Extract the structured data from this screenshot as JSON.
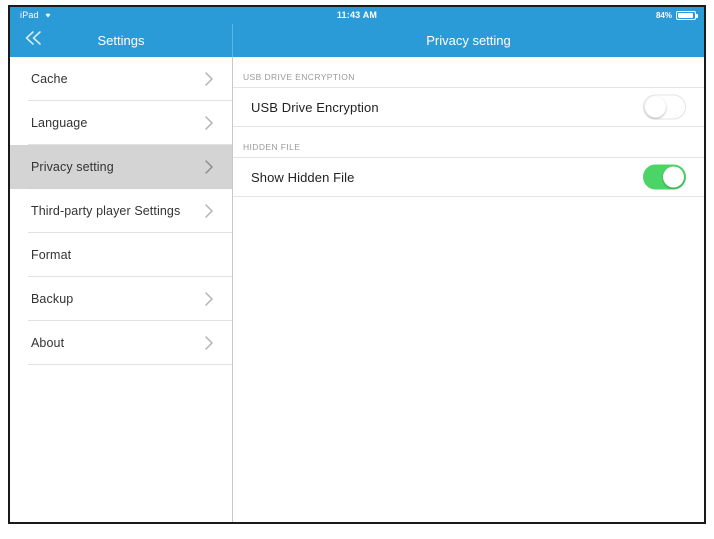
{
  "status_bar": {
    "device": "iPad",
    "wifi_icon": "wifi-icon",
    "time": "11:43 AM",
    "battery_percent": "84%",
    "battery_icon": "battery-icon"
  },
  "nav": {
    "back_icon": "double-chevron-left-icon",
    "left_title": "Settings",
    "right_title": "Privacy setting"
  },
  "sidebar": {
    "items": [
      {
        "label": "Cache",
        "chevron": true,
        "selected": false
      },
      {
        "label": "Language",
        "chevron": true,
        "selected": false
      },
      {
        "label": "Privacy setting",
        "chevron": true,
        "selected": true
      },
      {
        "label": "Third-party player Settings",
        "chevron": true,
        "selected": false
      },
      {
        "label": "Format",
        "chevron": false,
        "selected": false
      },
      {
        "label": "Backup",
        "chevron": true,
        "selected": false
      },
      {
        "label": "About",
        "chevron": true,
        "selected": false
      }
    ]
  },
  "detail": {
    "sections": [
      {
        "header": "USB DRIVE ENCRYPTION",
        "row_label": "USB Drive Encryption",
        "toggle_state": "off"
      },
      {
        "header": "HIDDEN FILE",
        "row_label": "Show Hidden File",
        "toggle_state": "on"
      }
    ]
  },
  "colors": {
    "nav_blue": "#2b9bd8",
    "toggle_on_green": "#4cd467",
    "selected_row_gray": "#d4d4d4",
    "separator_gray": "#e2e2e2",
    "section_header_text": "#9a9a9a"
  }
}
